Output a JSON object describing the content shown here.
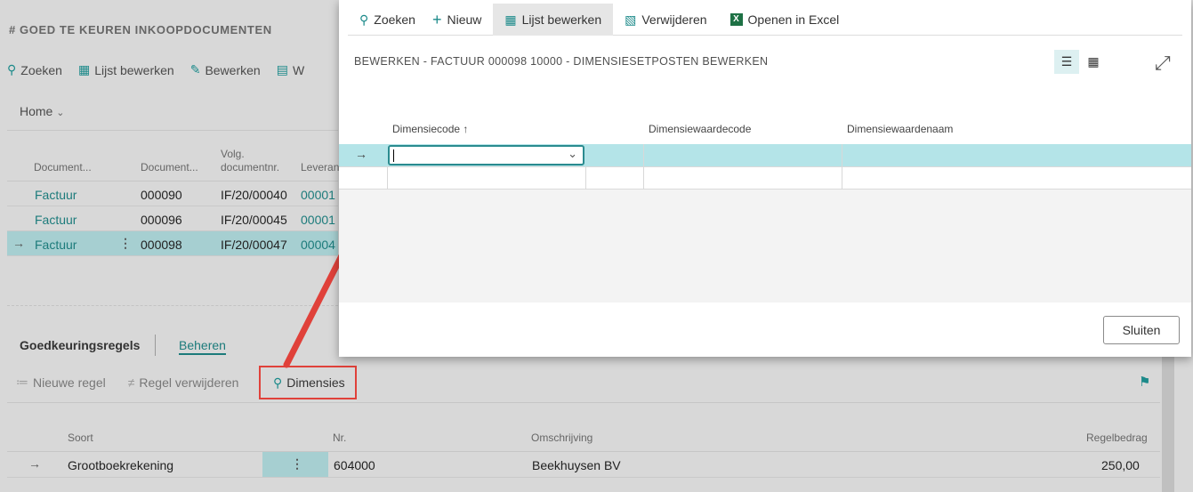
{
  "background": {
    "page_title": "# GOED TE KEUREN INKOOPDOCUMENTEN",
    "toolbar": {
      "search": "Zoeken",
      "edit_list": "Lijst bewerken",
      "edit": "Bewerken",
      "view_partial": "W"
    },
    "home": "Home",
    "list": {
      "col_doc_type": "Document...",
      "col_doc_no": "Document...",
      "col_seq_line1": "Volg.",
      "col_seq_line2": "documentnr.",
      "col_vendor": "Leveran",
      "rows": [
        {
          "type": "Factuur",
          "no": "000090",
          "seq": "IF/20/00040",
          "vendor": "00001"
        },
        {
          "type": "Factuur",
          "no": "000096",
          "seq": "IF/20/00045",
          "vendor": "00001"
        },
        {
          "type": "Factuur",
          "no": "000098",
          "seq": "IF/20/00047",
          "vendor": "00004"
        }
      ]
    },
    "section": {
      "title": "Goedkeuringsregels",
      "manage": "Beheren"
    },
    "lines_toolbar": {
      "new_line": "Nieuwe regel",
      "delete_line": "Regel verwijderen",
      "dimensions": "Dimensies"
    },
    "lines": {
      "col_type": "Soort",
      "col_no": "Nr.",
      "col_desc": "Omschrijving",
      "col_amount": "Regelbedrag",
      "row": {
        "type": "Grootboekrekening",
        "no": "604000",
        "desc": "Beekhuysen BV",
        "amount": "250,00"
      }
    }
  },
  "dialog": {
    "toolbar": {
      "search": "Zoeken",
      "new": "Nieuw",
      "edit_list": "Lijst bewerken",
      "delete": "Verwijderen",
      "excel": "Openen in Excel"
    },
    "title": "BEWERKEN - FACTUUR 000098 10000 - DIMENSIESETPOSTEN BEWERKEN",
    "columns": {
      "code": "Dimensiecode",
      "value_code": "Dimensiewaardecode",
      "value_name": "Dimensiewaardenaam"
    },
    "close": "Sluiten"
  },
  "colors": {
    "accent": "#1c7b7b",
    "highlight": "#e0413a",
    "selected_row": "#b4e4e8"
  }
}
